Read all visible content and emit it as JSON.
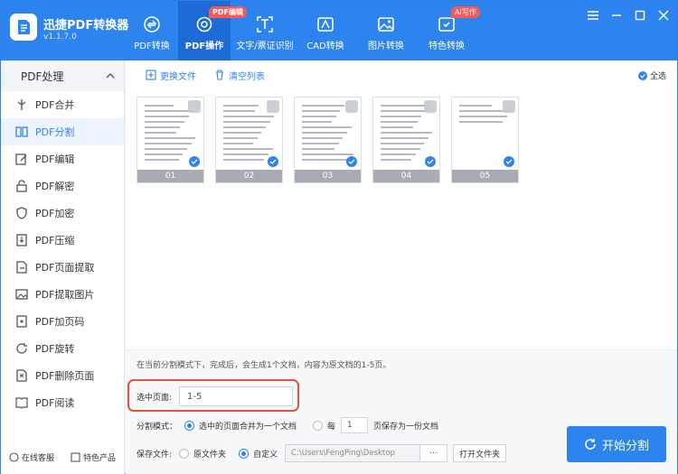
{
  "app": {
    "name": "迅捷PDF转换器",
    "version": "v1.1.7.0",
    "brand_color": "#2e84ee"
  },
  "nav": {
    "tabs": [
      {
        "label": "PDF转换",
        "icon": "convert-icon"
      },
      {
        "label": "PDF操作",
        "icon": "gear-icon",
        "badge": "PDF编辑",
        "active": true
      },
      {
        "label": "文字/票证识别",
        "icon": "scan-icon"
      },
      {
        "label": "CAD转换",
        "icon": "cad-icon"
      },
      {
        "label": "图片转换",
        "icon": "image-icon"
      },
      {
        "label": "特色转换",
        "icon": "special-icon",
        "badge": "AI写作"
      }
    ]
  },
  "sidebar": {
    "header": "PDF处理",
    "items": [
      {
        "label": "PDF合并"
      },
      {
        "label": "PDF分割",
        "active": true
      },
      {
        "label": "PDF编辑"
      },
      {
        "label": "PDF解密"
      },
      {
        "label": "PDF加密"
      },
      {
        "label": "PDF压缩"
      },
      {
        "label": "PDF页面提取"
      },
      {
        "label": "PDF提取图片"
      },
      {
        "label": "PDF加页码"
      },
      {
        "label": "PDF旋转"
      },
      {
        "label": "PDF删除页面"
      },
      {
        "label": "PDF阅读"
      }
    ],
    "footer": {
      "service": "在线客服",
      "products": "特色产品"
    }
  },
  "toolbar": {
    "replace_file": "更换文件",
    "clear_list": "清空列表",
    "select_all": "全选"
  },
  "pages": [
    {
      "label": "01"
    },
    {
      "label": "02"
    },
    {
      "label": "03"
    },
    {
      "label": "04"
    },
    {
      "label": "05"
    }
  ],
  "settings": {
    "info": "在当前分割模式下，完成后，会生成1个文档，内容为原文档的1-5页。",
    "selected_pages_label": "选中页面:",
    "selected_pages_value": "1-5",
    "split_mode_label": "分割模式：",
    "mode_merge": "选中的页面合并为一个文档",
    "mode_every": "每",
    "every_count": "1",
    "mode_every_suffix": "页保存为一份文档",
    "save_label": "保存文件:",
    "save_original": "原文件夹",
    "save_custom": "自定义",
    "save_path": "C:\\Users\\FengPing\\Desktop",
    "browse": "···",
    "open_folder": "打开文件夹",
    "start": "开始分割"
  }
}
